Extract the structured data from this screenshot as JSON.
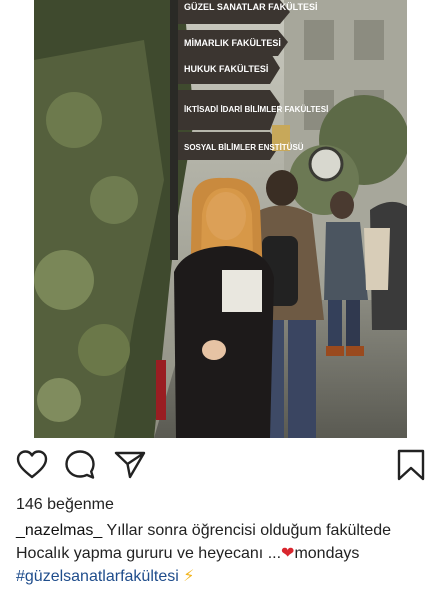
{
  "post": {
    "image_alt": "",
    "signs": [
      "GÜZEL SANATLAR FAKÜLTESİ",
      "MİMARLIK FAKÜLTESİ",
      "HUKUK FAKÜLTESİ",
      "İKTİSADİ İDARİ BİLİMLER FAKÜLTESİ",
      "SOSYAL BİLİMLER ENSTİTÜSÜ"
    ]
  },
  "actions": {
    "like_icon": "heart-outline-icon",
    "comment_icon": "speech-bubble-icon",
    "share_icon": "paper-plane-icon",
    "save_icon": "bookmark-icon"
  },
  "likes": {
    "text": "146 beğenme"
  },
  "caption": {
    "username": "_nazelmas_",
    "text": "Yıllar sonra öğrencisi olduğum fakültede Hocalık yapma gururu ve heyecanı ...",
    "heart": "❤",
    "after_heart": "mondays",
    "hashtag": "#güzelsanatlarfakültesi",
    "bolt": "⚡"
  },
  "colors": {
    "hashtag": "#1f4d8c",
    "heart": "#d9262e",
    "text": "#222222"
  }
}
